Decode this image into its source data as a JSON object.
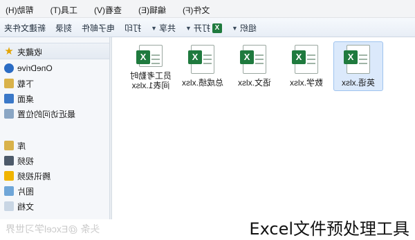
{
  "menubar": {
    "items": [
      "文件(F)",
      "编辑(E)",
      "查看(V)",
      "工具(T)",
      "帮助(H)"
    ]
  },
  "toolbar": {
    "organize": "组织",
    "open": "打开",
    "share": "共享",
    "print": "打印",
    "email": "电子邮件",
    "burn": "刻录",
    "new_folder": "新建文件夹"
  },
  "files": [
    {
      "name": "员工考勤时间表1.xlsx",
      "line1": "员工考勤时",
      "line2": "间表1.xlsx",
      "selected": false
    },
    {
      "name": "总成绩.xlsx",
      "line1": "总成绩.xlsx",
      "line2": "",
      "selected": false
    },
    {
      "name": "语文.xlsx",
      "line1": "语文.xlsx",
      "line2": "",
      "selected": false
    },
    {
      "name": "数学.xlsx",
      "line1": "数学.xlsx",
      "line2": "",
      "selected": false
    },
    {
      "name": "英语.xlsx",
      "line1": "英语.xlsx",
      "line2": "",
      "selected": true
    }
  ],
  "nav": {
    "favorites": "收藏夹",
    "onedrive": "OneDrive",
    "downloads": "下载",
    "desktop": "桌面",
    "recent": "最近访问的位置",
    "libraries": "库",
    "videos": "视频",
    "thunder_videos": "腾讯视频",
    "pictures": "图片",
    "documents": "文档"
  },
  "caption": "Excel文件预处理工具",
  "watermark": "头条 @Excel学习世界",
  "colors": {
    "excel_green": "#1f7a3e",
    "selection": "#dbe9fb"
  }
}
